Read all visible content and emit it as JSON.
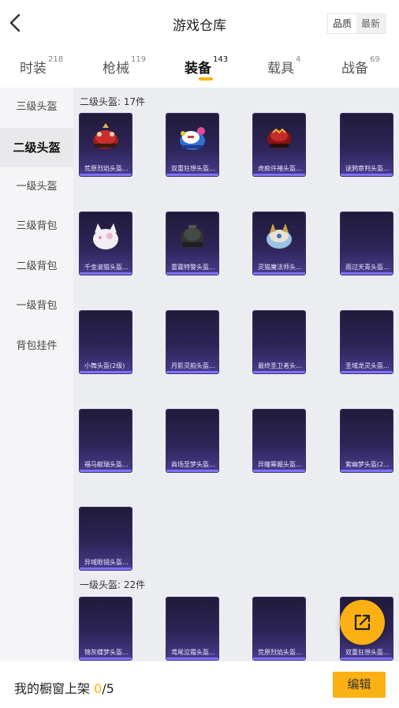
{
  "header": {
    "title": "游戏仓库",
    "sort_options": [
      "品质",
      "最新"
    ],
    "selected_sort": "最新"
  },
  "tabs": [
    {
      "label": "时装",
      "count": "218"
    },
    {
      "label": "枪械",
      "count": "119"
    },
    {
      "label": "装备",
      "count": "143",
      "active": true
    },
    {
      "label": "载具",
      "count": "4"
    },
    {
      "label": "战备",
      "count": "69"
    }
  ],
  "sidebar": {
    "items": [
      "三级头盔",
      "二级头盔",
      "一级头盔",
      "三级背包",
      "二级背包",
      "一级背包",
      "背包挂件"
    ],
    "active": "二级头盔"
  },
  "sections": [
    {
      "label": "二级头盔: 17件",
      "items": [
        {
          "name": "荒原烈焰头盔...",
          "icon": "red-pig-helmet"
        },
        {
          "name": "双重狂想头盔...",
          "icon": "blue-candy-helmet"
        },
        {
          "name": "虎痴许褚头盔...",
          "icon": "red-tiger-helmet"
        },
        {
          "name": "谜鸦审判头盔...",
          "icon": ""
        },
        {
          "name": "千金淑猫头盔...",
          "icon": "white-cat-helmet"
        },
        {
          "name": "雷霆特警头盔...",
          "icon": "black-swat-helmet"
        },
        {
          "name": "灵猫魔法师头...",
          "icon": "blue-cat-wizard-helmet"
        },
        {
          "name": "雨过天青头盔...",
          "icon": ""
        },
        {
          "name": "小舞头盔(2级)",
          "icon": ""
        },
        {
          "name": "月影灵韵头盔...",
          "icon": ""
        },
        {
          "name": "最终圣卫者头...",
          "icon": ""
        },
        {
          "name": "圣域龙灵头盔...",
          "icon": ""
        },
        {
          "name": "福马献瑞头盔...",
          "icon": ""
        },
        {
          "name": "商场至梦头盔...",
          "icon": ""
        },
        {
          "name": "异瞳幂媚头盔...",
          "icon": ""
        },
        {
          "name": "紫幽梦头盔(2...",
          "icon": ""
        },
        {
          "name": "异域眼镜头盔...",
          "icon": ""
        }
      ]
    },
    {
      "label": "一级头盔: 22件",
      "items": [
        {
          "name": "锦灰蝶梦头盔...",
          "icon": ""
        },
        {
          "name": "鸢尾泣霜头盔...",
          "icon": ""
        },
        {
          "name": "荒原烈焰头盔...",
          "icon": ""
        },
        {
          "name": "双重狂想头盔...",
          "icon": ""
        }
      ]
    }
  ],
  "bottom": {
    "showcase_prefix": "我的橱窗上架 ",
    "count_current": "0",
    "count_sep": "/",
    "count_max": "5",
    "edit_label": "编辑"
  },
  "colors": {
    "accent": "#fbb014",
    "card_top": "#201b3a",
    "card_bottom": "#4a3c8c",
    "card_border": "#7f72ff"
  },
  "icons": {
    "back": "chevron-left-icon",
    "fab": "share-external-icon"
  }
}
